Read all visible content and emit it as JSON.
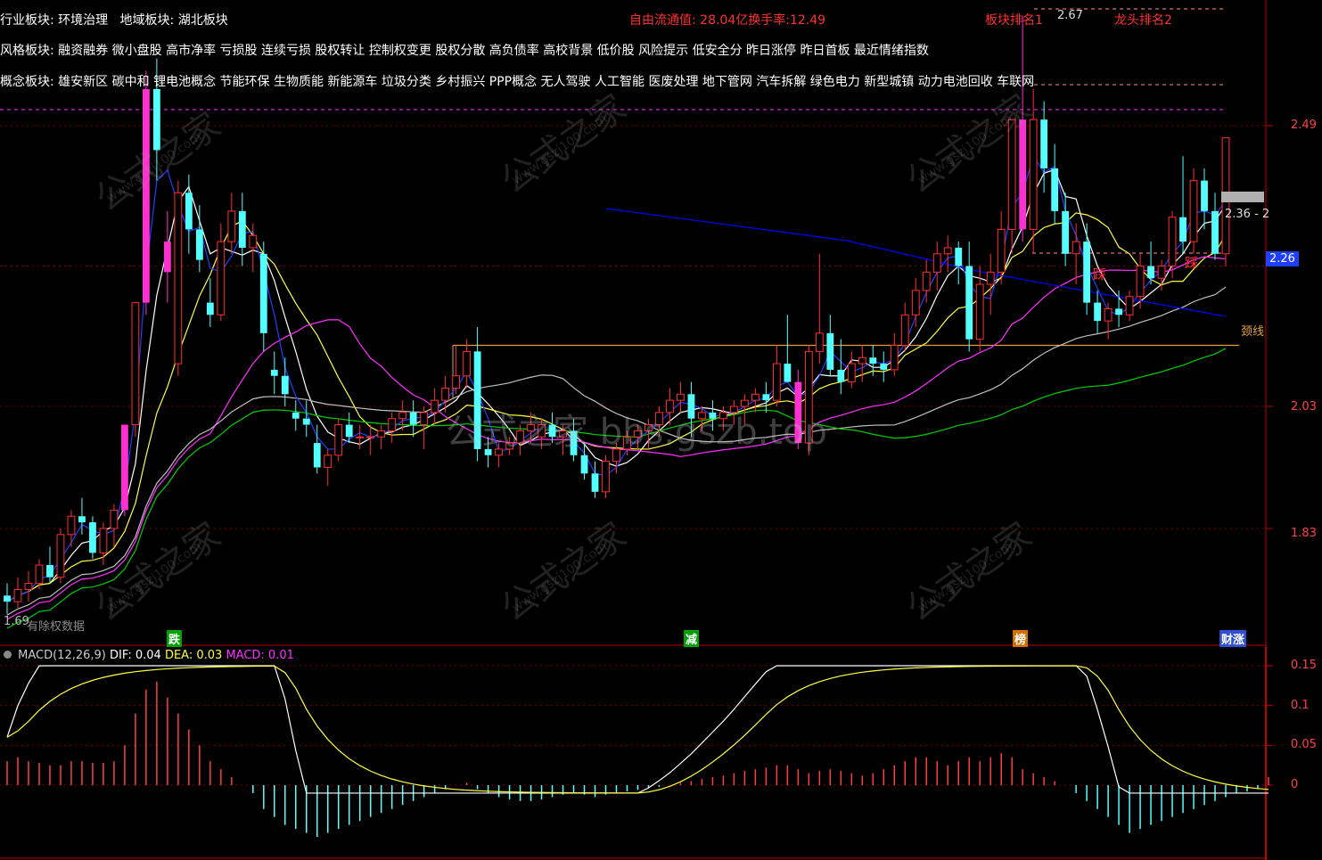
{
  "info": {
    "industry_label": "行业板块:",
    "industry_values": "环境治理",
    "region_label": "地域板块:",
    "region_values": "湖北板块",
    "style_label": "风格板块:",
    "style_values": "融资融券 微小盘股 高市净率 亏损股 连续亏损 股权转让 控制权变更 股权分散 高负债率 高校背景 低价股 风险提示 低安全分 昨日涨停 昨日首板 最近情绪指数",
    "concept_label": "概念板块:",
    "concept_values": "雄安新区 碳中和 锂电池概念 节能环保 生物质能 新能源车 垃圾分类 乡村振兴 PPP概念 无人驾驶 人工智能 医废处理 地下管网 汽车拆解 绿色电力 新型城镇 动力电池回收 车联网",
    "free_float": "自由流通值: 28.04亿换手率:12.49",
    "sector_rank": "板块排名1",
    "dragon_rank": "龙头排名2",
    "high_label": "2.67",
    "low_label": "1.69",
    "bottom_left": "有除权数据",
    "neckline": "颈线",
    "price_tag": "2.36 - 2",
    "current_price": "2.26"
  },
  "markers": [
    {
      "text": "跌",
      "color": "#ffffff",
      "bg": "#00a000"
    },
    {
      "text": "减",
      "color": "#ffffff",
      "bg": "#00a000"
    },
    {
      "text": "榜",
      "color": "#ffffff",
      "bg": "#d07000"
    },
    {
      "text": "财涨",
      "color": "#ffffff",
      "bg": "#3050d0"
    }
  ],
  "macd": {
    "name": "MACD(12,26,9)",
    "dif_label": "DIF: 0.04",
    "dea_label": "DEA: 0.03",
    "macd_label": "MACD: 0.01"
  },
  "watermark": {
    "cn": "公式之家",
    "url": "www.gszj100.com",
    "center": "公式之家 bbs.gszb.top"
  },
  "colors": {
    "up": "#ff3030",
    "down": "#54ffff",
    "limit_up": "#ff30d0",
    "ma5": "#ffffff",
    "ma10": "#ffff40",
    "ma20": "#ff30ff",
    "ma60": "#00d000",
    "long_ma": "#0000ff",
    "dif": "#ffffff",
    "dea": "#ffff40"
  },
  "chart_data": {
    "type": "candlestick",
    "y_axis_ticks": [
      2.49,
      2.26,
      2.03,
      1.83
    ],
    "macd_axis_ticks": [
      0.15,
      0.1,
      0.05,
      0.0
    ],
    "neckline_price": 2.13,
    "candles": [
      [
        1.72,
        1.74,
        1.69,
        1.71
      ],
      [
        1.71,
        1.75,
        1.7,
        1.73
      ],
      [
        1.73,
        1.76,
        1.71,
        1.74
      ],
      [
        1.74,
        1.78,
        1.73,
        1.77
      ],
      [
        1.77,
        1.8,
        1.74,
        1.75
      ],
      [
        1.75,
        1.83,
        1.74,
        1.82
      ],
      [
        1.82,
        1.86,
        1.8,
        1.85
      ],
      [
        1.85,
        1.88,
        1.82,
        1.84
      ],
      [
        1.84,
        1.85,
        1.78,
        1.79
      ],
      [
        1.79,
        1.84,
        1.77,
        1.83
      ],
      [
        1.83,
        1.87,
        1.8,
        1.86
      ],
      [
        1.86,
        2.0,
        1.85,
        2.0
      ],
      [
        2.0,
        2.2,
        1.98,
        2.2
      ],
      [
        2.2,
        2.58,
        2.18,
        2.55
      ],
      [
        2.55,
        2.6,
        2.4,
        2.45
      ],
      [
        2.3,
        2.35,
        2.2,
        2.25
      ],
      [
        2.1,
        2.4,
        2.08,
        2.38
      ],
      [
        2.38,
        2.41,
        2.28,
        2.32
      ],
      [
        2.32,
        2.36,
        2.25,
        2.27
      ],
      [
        2.2,
        2.24,
        2.16,
        2.18
      ],
      [
        2.18,
        2.33,
        2.17,
        2.3
      ],
      [
        2.3,
        2.38,
        2.28,
        2.35
      ],
      [
        2.35,
        2.38,
        2.26,
        2.29
      ],
      [
        2.29,
        2.33,
        2.25,
        2.31
      ],
      [
        2.28,
        2.3,
        2.12,
        2.15
      ],
      [
        2.09,
        2.12,
        2.05,
        2.08
      ],
      [
        2.08,
        2.11,
        2.03,
        2.05
      ],
      [
        2.02,
        2.04,
        1.99,
        2.01
      ],
      [
        2.01,
        2.04,
        1.98,
        2.0
      ],
      [
        1.97,
        2.0,
        1.92,
        1.93
      ],
      [
        1.93,
        1.96,
        1.9,
        1.95
      ],
      [
        1.95,
        2.01,
        1.94,
        2.0
      ],
      [
        2.0,
        2.02,
        1.97,
        1.98
      ],
      [
        1.98,
        2.0,
        1.96,
        1.98
      ],
      [
        1.98,
        2.0,
        1.95,
        1.98
      ],
      [
        1.98,
        2.0,
        1.96,
        1.99
      ],
      [
        1.99,
        2.02,
        1.97,
        2.01
      ],
      [
        2.01,
        2.04,
        1.99,
        2.02
      ],
      [
        2.02,
        2.04,
        1.98,
        2.0
      ],
      [
        2.0,
        2.03,
        1.96,
        2.02
      ],
      [
        2.02,
        2.06,
        2.0,
        2.04
      ],
      [
        2.04,
        2.08,
        2.02,
        2.06
      ],
      [
        2.06,
        2.13,
        2.05,
        2.08
      ],
      [
        2.08,
        2.14,
        2.06,
        2.12
      ],
      [
        2.12,
        2.16,
        1.94,
        1.96
      ],
      [
        1.96,
        1.98,
        1.93,
        1.95
      ],
      [
        1.95,
        1.97,
        1.93,
        1.96
      ],
      [
        1.96,
        1.98,
        1.95,
        1.97
      ],
      [
        1.97,
        2.0,
        1.95,
        1.99
      ],
      [
        1.99,
        2.02,
        1.97,
        2.0
      ],
      [
        1.98,
        2.01,
        1.96,
        2.0
      ],
      [
        2.0,
        2.02,
        1.97,
        1.98
      ],
      [
        1.98,
        2.0,
        1.95,
        1.99
      ],
      [
        1.99,
        2.01,
        1.94,
        1.95
      ],
      [
        1.95,
        1.97,
        1.91,
        1.92
      ],
      [
        1.92,
        1.94,
        1.88,
        1.89
      ],
      [
        1.89,
        1.95,
        1.88,
        1.94
      ],
      [
        1.94,
        1.97,
        1.92,
        1.96
      ],
      [
        1.96,
        1.99,
        1.95,
        1.98
      ],
      [
        1.98,
        2.0,
        1.96,
        1.99
      ],
      [
        1.99,
        2.01,
        1.96,
        2.0
      ],
      [
        2.0,
        2.03,
        1.98,
        2.02
      ],
      [
        2.02,
        2.06,
        2.0,
        2.04
      ],
      [
        2.04,
        2.07,
        2.02,
        2.05
      ],
      [
        2.05,
        2.07,
        1.98,
        2.01
      ],
      [
        2.01,
        2.03,
        1.99,
        2.02
      ],
      [
        2.02,
        2.04,
        1.99,
        2.01
      ],
      [
        2.01,
        2.03,
        1.99,
        2.02
      ],
      [
        2.02,
        2.04,
        2.0,
        2.03
      ],
      [
        2.03,
        2.05,
        2.0,
        2.04
      ],
      [
        2.04,
        2.06,
        2.02,
        2.05
      ],
      [
        2.05,
        2.07,
        2.02,
        2.04
      ],
      [
        2.04,
        2.13,
        2.03,
        2.1
      ],
      [
        2.1,
        2.18,
        2.07,
        2.07
      ],
      [
        2.07,
        2.09,
        1.96,
        1.97
      ],
      [
        1.97,
        2.13,
        1.95,
        2.12
      ],
      [
        2.12,
        2.28,
        2.1,
        2.15
      ],
      [
        2.15,
        2.18,
        2.08,
        2.09
      ],
      [
        2.09,
        2.14,
        2.05,
        2.07
      ],
      [
        2.07,
        2.12,
        2.06,
        2.1
      ],
      [
        2.1,
        2.13,
        2.07,
        2.11
      ],
      [
        2.11,
        2.13,
        2.08,
        2.1
      ],
      [
        2.1,
        2.12,
        2.07,
        2.09
      ],
      [
        2.09,
        2.15,
        2.08,
        2.13
      ],
      [
        2.13,
        2.2,
        2.12,
        2.18
      ],
      [
        2.18,
        2.24,
        2.16,
        2.22
      ],
      [
        2.22,
        2.27,
        2.2,
        2.25
      ],
      [
        2.25,
        2.3,
        2.22,
        2.28
      ],
      [
        2.28,
        2.31,
        2.25,
        2.29
      ],
      [
        2.29,
        2.3,
        2.23,
        2.26
      ],
      [
        2.26,
        2.3,
        2.12,
        2.14
      ],
      [
        2.14,
        2.26,
        2.12,
        2.23
      ],
      [
        2.23,
        2.28,
        2.18,
        2.25
      ],
      [
        2.25,
        2.35,
        2.23,
        2.32
      ],
      [
        2.32,
        2.5,
        2.28,
        2.5
      ],
      [
        2.5,
        2.67,
        2.3,
        2.32
      ],
      [
        2.32,
        2.55,
        2.28,
        2.5
      ],
      [
        2.5,
        2.53,
        2.38,
        2.42
      ],
      [
        2.42,
        2.46,
        2.33,
        2.35
      ],
      [
        2.35,
        2.38,
        2.26,
        2.28
      ],
      [
        2.28,
        2.33,
        2.23,
        2.3
      ],
      [
        2.3,
        2.33,
        2.18,
        2.2
      ],
      [
        2.2,
        2.22,
        2.15,
        2.17
      ],
      [
        2.17,
        2.2,
        2.14,
        2.19
      ],
      [
        2.19,
        2.22,
        2.16,
        2.18
      ],
      [
        2.18,
        2.22,
        2.17,
        2.21
      ],
      [
        2.21,
        2.28,
        2.19,
        2.26
      ],
      [
        2.26,
        2.3,
        2.23,
        2.24
      ],
      [
        2.24,
        2.27,
        2.22,
        2.26
      ],
      [
        2.26,
        2.35,
        2.24,
        2.34
      ],
      [
        2.34,
        2.44,
        2.28,
        2.3
      ],
      [
        2.3,
        2.42,
        2.28,
        2.4
      ],
      [
        2.4,
        2.42,
        2.32,
        2.35
      ],
      [
        2.35,
        2.38,
        2.27,
        2.28
      ],
      [
        2.28,
        2.47,
        2.26,
        2.47
      ]
    ],
    "limit_up_indices": [
      11,
      13,
      15,
      74,
      95
    ],
    "macd_hist": [
      0.03,
      0.035,
      0.03,
      0.028,
      0.025,
      0.025,
      0.03,
      0.03,
      0.028,
      0.028,
      0.03,
      0.05,
      0.09,
      0.12,
      0.13,
      0.11,
      0.09,
      0.07,
      0.05,
      0.03,
      0.02,
      0.01,
      0.0,
      -0.01,
      -0.03,
      -0.04,
      -0.05,
      -0.055,
      -0.06,
      -0.065,
      -0.06,
      -0.055,
      -0.05,
      -0.045,
      -0.04,
      -0.035,
      -0.03,
      -0.025,
      -0.02,
      -0.015,
      -0.01,
      -0.005,
      0.0,
      0.003,
      -0.005,
      -0.01,
      -0.015,
      -0.018,
      -0.02,
      -0.02,
      -0.018,
      -0.015,
      -0.012,
      -0.01,
      -0.012,
      -0.015,
      -0.012,
      -0.01,
      -0.008,
      -0.006,
      -0.004,
      -0.002,
      0.0,
      0.003,
      0.005,
      0.008,
      0.01,
      0.012,
      0.015,
      0.018,
      0.02,
      0.022,
      0.025,
      0.025,
      0.02,
      0.015,
      0.018,
      0.02,
      0.018,
      0.015,
      0.012,
      0.015,
      0.02,
      0.025,
      0.03,
      0.035,
      0.035,
      0.03,
      0.025,
      0.03,
      0.035,
      0.03,
      0.035,
      0.04,
      0.035,
      0.02,
      0.015,
      0.01,
      0.005,
      0.0,
      -0.01,
      -0.02,
      -0.03,
      -0.04,
      -0.05,
      -0.06,
      -0.055,
      -0.05,
      -0.045,
      -0.04,
      -0.035,
      -0.03,
      -0.025,
      -0.02,
      -0.015,
      -0.01,
      -0.008,
      -0.004,
      0.01
    ]
  }
}
